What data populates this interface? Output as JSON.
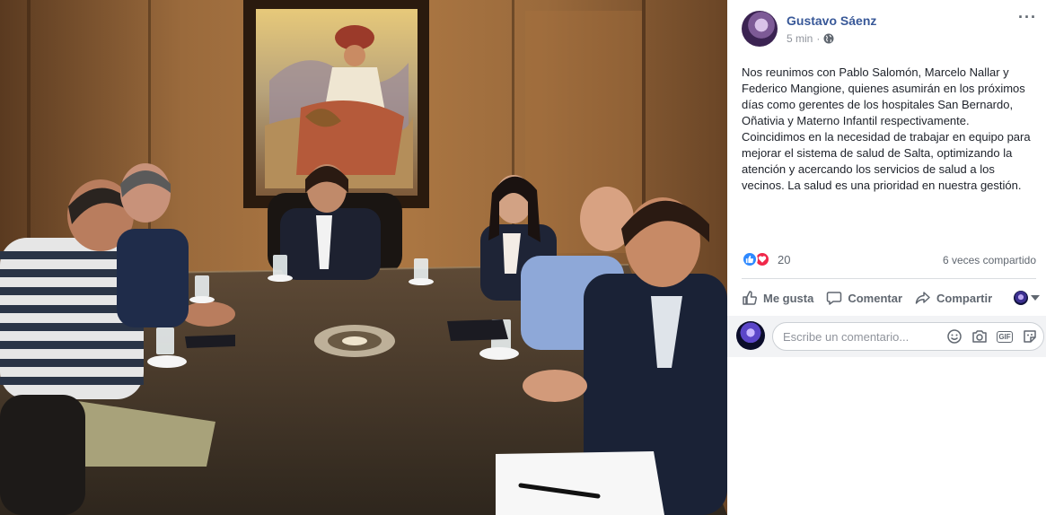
{
  "post": {
    "author": "Gustavo Sáenz",
    "time": "5 min",
    "more_icon": "···",
    "privacy_icon": "globe-icon",
    "text": "Nos reunimos con Pablo Salomón, Marcelo Nallar y Federico Mangione, quienes asumirán en los próximos días como gerentes de los hospitales San Bernardo, Oñativia y Materno Infantil respectivamente. Coincidimos en la necesidad de trabajar en equipo para mejorar el sistema de salud de Salta, optimizando la atención y acercando los servicios de salud a los vecinos. La salud es una prioridad en nuestra gestión."
  },
  "reactions": {
    "count": "20",
    "types": [
      "like-icon",
      "love-icon"
    ],
    "shares": "6 veces compartido"
  },
  "actions": {
    "like": "Me gusta",
    "comment": "Comentar",
    "share": "Compartir"
  },
  "comment": {
    "placeholder": "Escribe un comentario...",
    "tools": [
      "emoji-icon",
      "camera-icon",
      "gif-icon",
      "sticker-icon"
    ],
    "gif_label": "GIF"
  },
  "colors": {
    "link": "#385898",
    "secondary_text": "#606770",
    "like_blue": "#2e89ff",
    "love_red": "#f0284a"
  }
}
